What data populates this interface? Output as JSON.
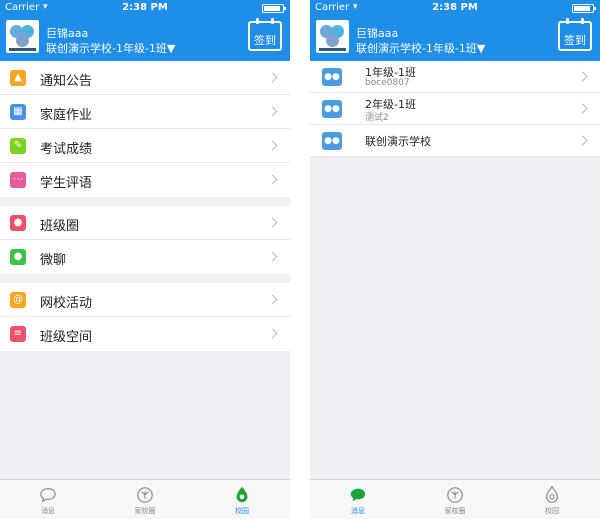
{
  "status": {
    "carrier": "Carrier",
    "time": "2:38 PM"
  },
  "header": {
    "user_name": "巨锦aaa",
    "school_line": "联创演示学校-1年级-1班▼",
    "signin_label": "签到"
  },
  "menu": {
    "groups": [
      [
        {
          "label": "通知公告",
          "icon": "megaphone-icon",
          "color": "#f5a623"
        },
        {
          "label": "家庭作业",
          "icon": "book-icon",
          "color": "#4a90e2"
        },
        {
          "label": "考试成绩",
          "icon": "report-icon",
          "color": "#7ed321"
        },
        {
          "label": "学生评语",
          "icon": "comment-icon",
          "color": "#e35d9b"
        }
      ],
      [
        {
          "label": "班级圈",
          "icon": "circle-icon",
          "color": "#f0506e"
        },
        {
          "label": "微聊",
          "icon": "chat-icon",
          "color": "#3cc24a"
        }
      ],
      [
        {
          "label": "网校活动",
          "icon": "at-icon",
          "color": "#f5a623"
        },
        {
          "label": "班级空间",
          "icon": "list-icon",
          "color": "#f0506e"
        }
      ]
    ]
  },
  "classes": [
    {
      "name": "1年级-1班",
      "sub": "boce0807"
    },
    {
      "name": "2年级-1班",
      "sub": "测试2"
    },
    {
      "name": "联创演示学校",
      "sub": ""
    }
  ],
  "tabs": [
    {
      "label": "消息",
      "icon": "chat-bubble-icon"
    },
    {
      "label": "家校圈",
      "icon": "butterfly-icon"
    },
    {
      "label": "校园",
      "icon": "drop-icon"
    }
  ],
  "colors": {
    "brand": "#1e8ee8",
    "background": "#f0eff4"
  }
}
